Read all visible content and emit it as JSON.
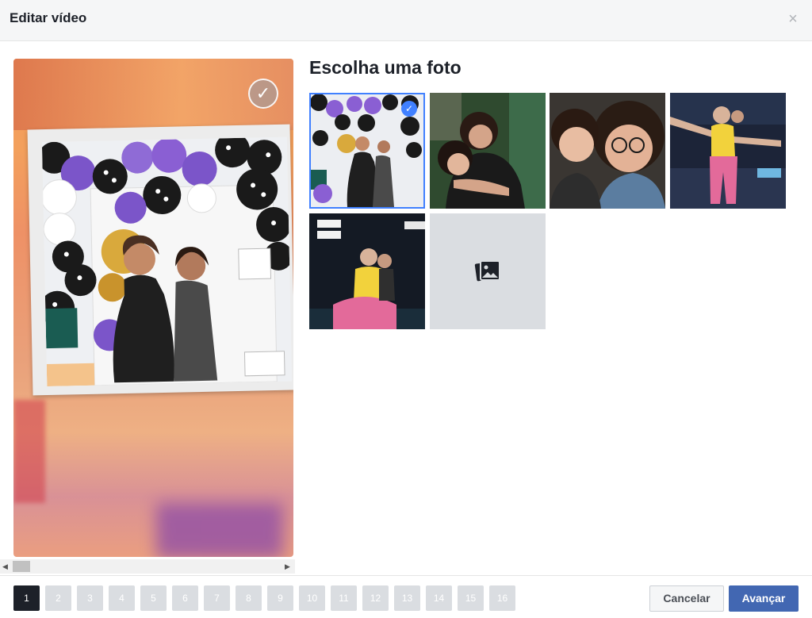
{
  "header": {
    "title": "Editar vídeo",
    "close_glyph": "×"
  },
  "preview": {
    "check_glyph": "✓"
  },
  "picker": {
    "title": "Escolha uma foto",
    "thumbnails": [
      {
        "name": "party-balloons-photo",
        "selected": true
      },
      {
        "name": "hug-green-wall-photo",
        "selected": false
      },
      {
        "name": "two-girls-glasses-photo",
        "selected": false
      },
      {
        "name": "girl-yellow-shirt-arms-out-photo",
        "selected": false
      },
      {
        "name": "girls-yellow-shirt-stage-photo",
        "selected": false
      }
    ],
    "upload_icon": "photo-gallery-icon"
  },
  "scrollbar": {
    "left_arrow": "◀",
    "right_arrow": "▶"
  },
  "pagination": {
    "pages": [
      "1",
      "2",
      "3",
      "4",
      "5",
      "6",
      "7",
      "8",
      "9",
      "10",
      "11",
      "12",
      "13",
      "14",
      "15",
      "16"
    ],
    "active": "1"
  },
  "footer": {
    "cancel_label": "Cancelar",
    "next_label": "Avançar"
  },
  "colors": {
    "accent": "#4267b2",
    "selection": "#4080ff",
    "active_page": "#1d2129"
  }
}
